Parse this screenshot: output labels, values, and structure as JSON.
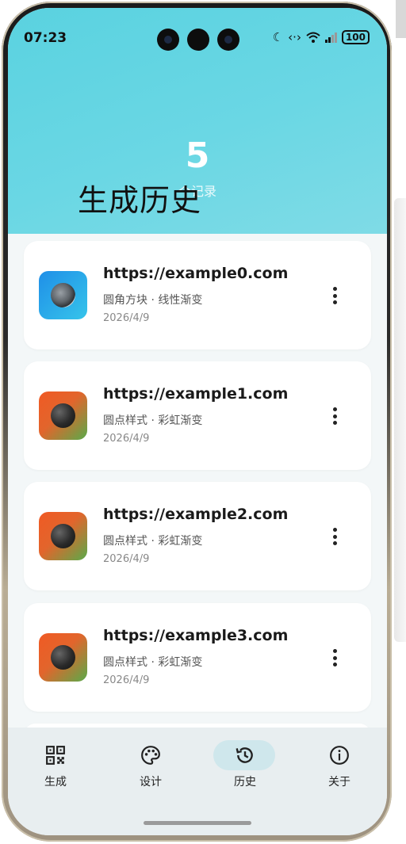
{
  "status_bar": {
    "time": "07:23",
    "battery": "100",
    "icons": [
      "moon-icon",
      "data-transfer-icon",
      "wifi-icon",
      "signal-icon",
      "battery-icon"
    ]
  },
  "header": {
    "count": "5",
    "count_label": "个记录",
    "title": "生成历史",
    "accent_color": "#5ad2e0"
  },
  "history": [
    {
      "url": "https://example0.com",
      "style": "圆角方块 · 线性渐变",
      "date": "2026/4/9",
      "thumb": "blue"
    },
    {
      "url": "https://example1.com",
      "style": "圆点样式 · 彩虹渐变",
      "date": "2026/4/9",
      "thumb": "rainbow"
    },
    {
      "url": "https://example2.com",
      "style": "圆点样式 · 彩虹渐变",
      "date": "2026/4/9",
      "thumb": "rainbow"
    },
    {
      "url": "https://example3.com",
      "style": "圆点样式 · 彩虹渐变",
      "date": "2026/4/9",
      "thumb": "rainbow"
    }
  ],
  "tabbar": {
    "items": [
      {
        "label": "生成",
        "icon": "qr-code-icon"
      },
      {
        "label": "设计",
        "icon": "palette-icon"
      },
      {
        "label": "历史",
        "icon": "history-icon",
        "active": true
      },
      {
        "label": "关于",
        "icon": "info-icon"
      }
    ]
  }
}
